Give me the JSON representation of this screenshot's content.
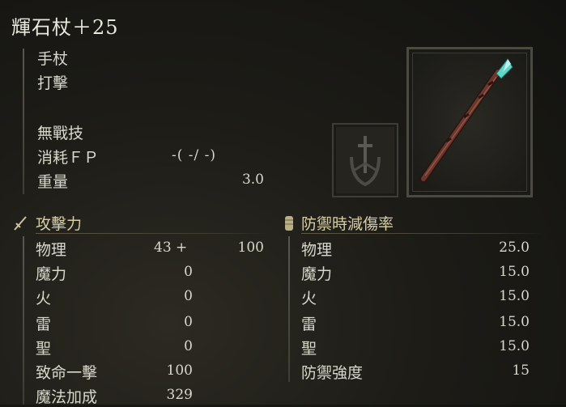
{
  "item": {
    "name": "輝石杖＋25",
    "weapon_type": "手杖",
    "damage_type": "打擊",
    "skill": "無戰技",
    "fp_label": "消耗ＦＰ",
    "fp_value": "-(  -/  -)",
    "weight_label": "重量",
    "weight_value": "3.0"
  },
  "attack": {
    "heading": "攻擊力",
    "rows": [
      {
        "label": "物理",
        "value": "43 +",
        "extra": "100"
      },
      {
        "label": "魔力",
        "value": "0",
        "extra": ""
      },
      {
        "label": "火",
        "value": "0",
        "extra": ""
      },
      {
        "label": "雷",
        "value": "0",
        "extra": ""
      },
      {
        "label": "聖",
        "value": "0",
        "extra": ""
      },
      {
        "label": "致命一擊",
        "value": "100",
        "extra": ""
      },
      {
        "label": "魔法加成",
        "value": "329",
        "extra": ""
      }
    ]
  },
  "defense": {
    "heading": "防禦時減傷率",
    "rows": [
      {
        "label": "物理",
        "value": "25.0"
      },
      {
        "label": "魔力",
        "value": "15.0"
      },
      {
        "label": "火",
        "value": "15.0"
      },
      {
        "label": "雷",
        "value": "15.0"
      },
      {
        "label": "聖",
        "value": "15.0"
      },
      {
        "label": "防禦強度",
        "value": "15"
      }
    ]
  },
  "icons": {
    "attack": "sword-icon",
    "defense": "shield-cylinder-icon",
    "ash_of_war": "ash-of-war-icon",
    "weapon": "glintstone-staff-icon"
  }
}
